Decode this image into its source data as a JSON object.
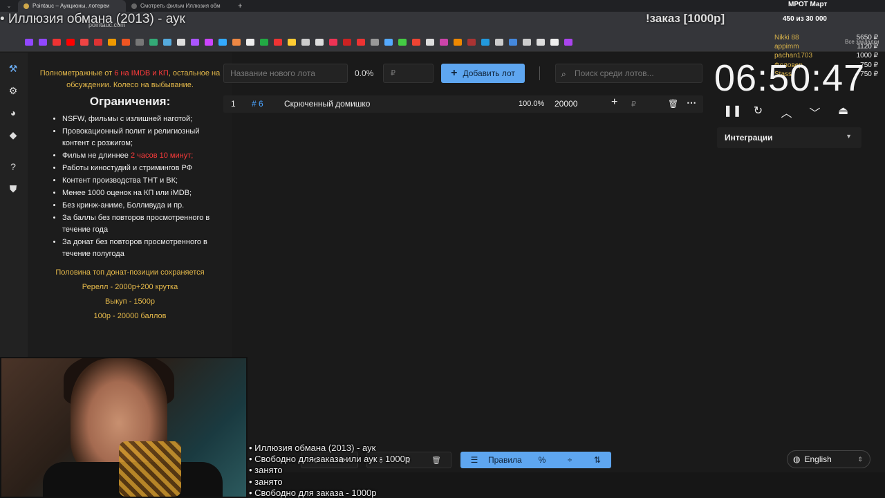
{
  "browser": {
    "tabs": [
      {
        "label": "Pointauc – Аукционы, лотереи"
      },
      {
        "label": "Смотреть фильм Иллюзия обм"
      }
    ],
    "url": "pointauc.com",
    "all_bookmarks": "Все закладки"
  },
  "overlay": {
    "current_title": "• Иллюзия обмана (2013) - аук",
    "order_label": "!заказ [1000р]",
    "mrot_label": "МРОТ Март",
    "counter": "450  из 30 000",
    "donors": [
      {
        "name": "Nikki 88",
        "amount": "5650 ₽"
      },
      {
        "name": "appimm",
        "amount": "1120 ₽"
      },
      {
        "name": "pachan1703",
        "amount": "1000 ₽"
      },
      {
        "name": "Фоловер",
        "amount": "750 ₽"
      },
      {
        "name": "Stassy",
        "amount": "750 ₽"
      }
    ],
    "queue": [
      "• Иллюзия обмана (2013) - аук",
      "• Свободно для заказа или аук - 1000р",
      "• занято",
      "• занято",
      "• Свободно для заказа - 1000р"
    ]
  },
  "rules_panel": {
    "intro_a": "Полнометражные от ",
    "intro_red": "6 на IMDB и КП",
    "intro_b": ", остальное на обсуждении. Колесо на выбывание.",
    "heading": "Ограничения:",
    "items": [
      {
        "text": "NSFW, фильмы с излишней наготой;"
      },
      {
        "text": "Провокационный полит и религиозный контент с розжигом;"
      },
      {
        "text": "Фильм не длиннее ",
        "red": "2 часов 10 минут;"
      },
      {
        "text": "Работы киностудий и стримингов РФ"
      },
      {
        "text": "Контент производства ТНТ и ВК;"
      },
      {
        "text": "Менее 1000 оценок на КП или iMDB;"
      },
      {
        "text": "Без кринж-аниме, Болливуда и пр."
      },
      {
        "text": "За баллы без повторов просмотренного в течение года"
      },
      {
        "text": "За донат без повторов просмотренного в течение полугода"
      }
    ],
    "footer": [
      "Половина топ донат-позиции сохраняется",
      "Ререлл - 2000р+200 крутка",
      "Выкуп - 1500р",
      "100р - 20000 баллов"
    ]
  },
  "lot_form": {
    "name_placeholder": "Название нового лота",
    "percent_total": "0.0%",
    "amount_placeholder": "₽",
    "add_label": "Добавить лот",
    "search_placeholder": "Поиск среди лотов..."
  },
  "lots": [
    {
      "index": "1",
      "id": "# 6",
      "name": "Скрюченный домишко",
      "percent": "100.0%",
      "amount": "20000",
      "currency": "₽"
    }
  ],
  "timer": {
    "display": "06:50:47",
    "integrations_label": "Интеграции"
  },
  "bottom": {
    "rules_label": "Правила",
    "language": "English"
  },
  "icons": {
    "sidebar": [
      "auction-icon",
      "settings-icon",
      "wheel-icon",
      "layers-icon",
      "help-icon",
      "shield-icon"
    ]
  },
  "colors": {
    "accent": "#5ea6f0",
    "rules_yellow": "#e5b94a",
    "rules_red": "#ff3b3b",
    "lot_id": "#4aa3ff"
  }
}
